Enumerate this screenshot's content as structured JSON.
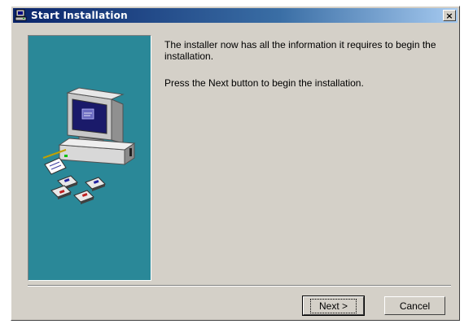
{
  "window": {
    "title": "Start Installation",
    "close_label": "×"
  },
  "content": {
    "paragraph1": "The installer now has all the information it requires to begin the installation.",
    "paragraph2": "Press the Next button to begin the installation."
  },
  "buttons": {
    "next_label": "Next >",
    "cancel_label": "Cancel"
  },
  "colors": {
    "side_panel": "#2a8898",
    "titlebar_start": "#0a246a",
    "titlebar_end": "#a6caf0",
    "dialog_bg": "#d4d0c8"
  },
  "icons": {
    "title": "installer-icon",
    "illustration": "computer-with-disks-icon"
  }
}
